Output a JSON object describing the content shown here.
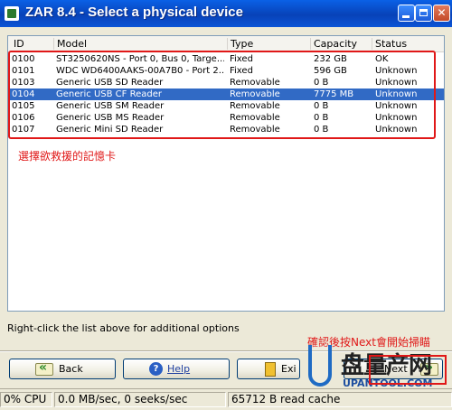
{
  "window": {
    "title": "ZAR 8.4 - Select a physical device"
  },
  "list": {
    "columns": [
      "ID",
      "Model",
      "Type",
      "Capacity",
      "Status"
    ],
    "rows": [
      [
        "0100",
        "ST3250620NS - Port 0, Bus 0, Targe...",
        "Fixed",
        "232 GB",
        "OK"
      ],
      [
        "0101",
        "WDC WD6400AAKS-00A7B0 - Port 2...",
        "Fixed",
        "596 GB",
        "Unknown"
      ],
      [
        "0103",
        "Generic USB SD Reader",
        "Removable",
        "0 B",
        "Unknown"
      ],
      [
        "0104",
        "Generic USB CF Reader",
        "Removable",
        "7775 MB",
        "Unknown"
      ],
      [
        "0105",
        "Generic USB SM Reader",
        "Removable",
        "0 B",
        "Unknown"
      ],
      [
        "0106",
        "Generic USB MS Reader",
        "Removable",
        "0 B",
        "Unknown"
      ],
      [
        "0107",
        "Generic Mini SD Reader",
        "Removable",
        "0 B",
        "Unknown"
      ]
    ],
    "selected_index": 3
  },
  "annotations": {
    "select_card": "選擇欲救援的記憶卡",
    "press_next": "確認後按Next會開始掃瞄"
  },
  "hint": "Right-click the list above for additional options",
  "buttons": {
    "back": "Back",
    "help": "Help",
    "exit": "Exi",
    "next": "Next"
  },
  "watermark": {
    "brand_cn": "盘量产网",
    "url": "UPANTOOL.COM"
  },
  "statusbar": {
    "cpu": "0% CPU",
    "io": "0.0 MB/sec, 0 seeks/sec",
    "cache": "65712 B read cache"
  },
  "colors": {
    "title_bar": "#0a61e6",
    "selection": "#316ac5",
    "annotation_red": "#e01818"
  }
}
